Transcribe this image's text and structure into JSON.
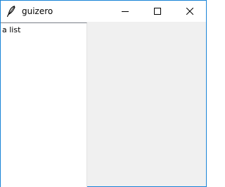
{
  "window": {
    "title": "guizero",
    "icon": "feather-icon",
    "controls": {
      "minimize_icon": "minimize-icon",
      "maximize_icon": "maximize-icon",
      "close_icon": "close-icon"
    }
  },
  "listbox": {
    "items": [
      "a list"
    ]
  },
  "colors": {
    "window_border": "#1883d7",
    "titlebar_bg": "#ffffff",
    "client_bg": "#f0f0f0",
    "listbox_bg": "#ffffff",
    "text": "#000000"
  }
}
